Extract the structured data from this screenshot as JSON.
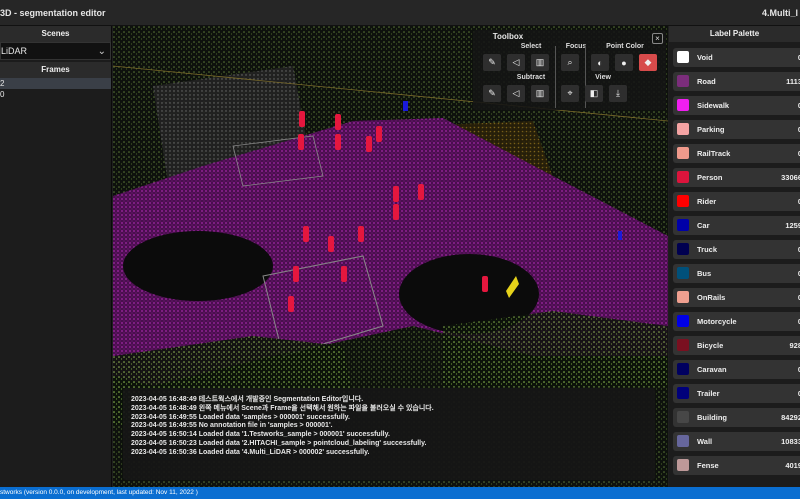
{
  "app": {
    "title": "3D - segmentation editor",
    "right_title": "4.Multi_l"
  },
  "scenes": {
    "header": "Scenes",
    "selected": "LiDAR"
  },
  "frames": {
    "header": "Frames",
    "items": [
      "2",
      "0"
    ]
  },
  "toolbox": {
    "title": "Toolbox",
    "close": "×",
    "sections": {
      "select": "Select",
      "subtract": "Subtract",
      "focus": "Focus",
      "view": "View",
      "point_color": "Point Color"
    }
  },
  "log": [
    "2023-04-05 16:48:49 테스트웍스에서 개발중인 Segmentation Editor입니다.",
    "2023-04-05 16:48:49 왼쪽 메뉴에서 Scene과 Frame을 선택해서 원하는 파일을 불러오실 수 있습니다.",
    "2023-04-05 16:49:55 Loaded data 'samples > 000001' successfully.",
    "2023-04-05 16:49:55 No annotation file in 'samples > 000001'.",
    "2023-04-05 16:50:14 Loaded data '1.Testworks_sample > 000001' successfully.",
    "2023-04-05 16:50:23 Loaded data '2.HITACHI_sample > pointcloud_labeling' successfully.",
    "2023-04-05 16:50:36 Loaded data '4.Multi_LiDAR > 000002' successfully."
  ],
  "palette": {
    "header": "Label Palette",
    "items": [
      {
        "name": "Void",
        "count": "0",
        "color": "#ffffff"
      },
      {
        "name": "Road",
        "count": "1113",
        "color": "#7b2d7b"
      },
      {
        "name": "Sidewalk",
        "count": "0",
        "color": "#f01ef0"
      },
      {
        "name": "Parking",
        "count": "0",
        "color": "#f4a3a3"
      },
      {
        "name": "RailTrack",
        "count": "0",
        "color": "#f09a8c"
      },
      {
        "name": "Person",
        "count": "33066",
        "color": "#dc143c"
      },
      {
        "name": "Rider",
        "count": "0",
        "color": "#ff0000"
      },
      {
        "name": "Car",
        "count": "1259",
        "color": "#0000a8"
      },
      {
        "name": "Truck",
        "count": "0",
        "color": "#000050"
      },
      {
        "name": "Bus",
        "count": "0",
        "color": "#00507a"
      },
      {
        "name": "OnRails",
        "count": "0",
        "color": "#f0a090"
      },
      {
        "name": "Motorcycle",
        "count": "0",
        "color": "#0000e6"
      },
      {
        "name": "Bicycle",
        "count": "928",
        "color": "#7a1020"
      },
      {
        "name": "Caravan",
        "count": "0",
        "color": "#000060"
      },
      {
        "name": "Trailer",
        "count": "0",
        "color": "#00007a"
      },
      {
        "name": "Building",
        "count": "84292",
        "color": "#474747"
      },
      {
        "name": "Wall",
        "count": "10833",
        "color": "#66669c"
      },
      {
        "name": "Fense",
        "count": "4019",
        "color": "#be9999"
      }
    ]
  },
  "status": {
    "text": "stworks (version 0.0.0, on development, last updated: Nov 11, 2022 )"
  }
}
